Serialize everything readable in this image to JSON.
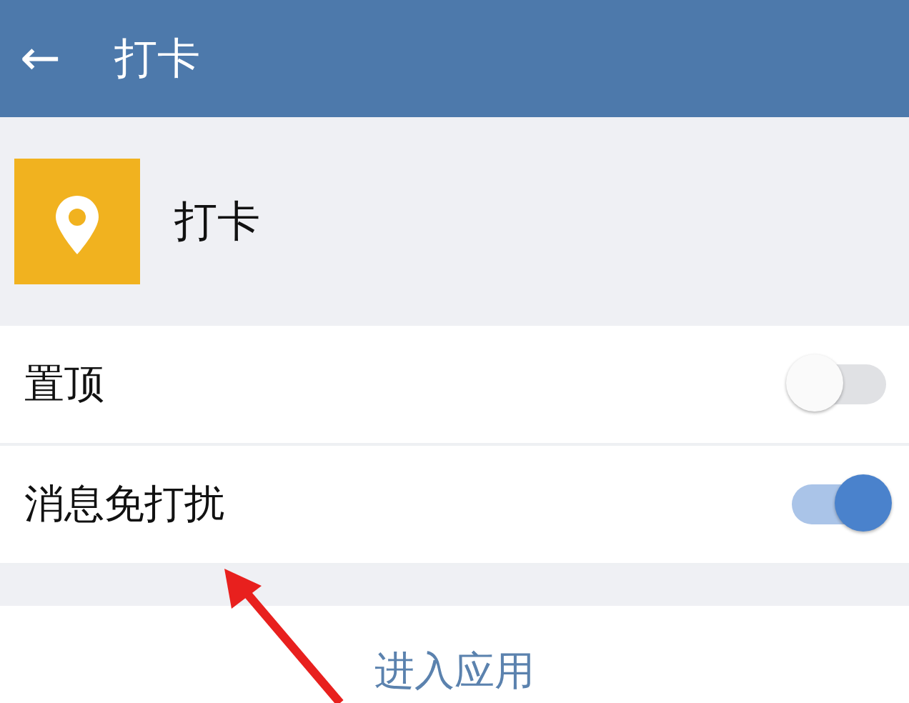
{
  "header": {
    "back": "←",
    "title": "打卡"
  },
  "app": {
    "name": "打卡"
  },
  "settings": [
    {
      "label": "置顶",
      "on": false
    },
    {
      "label": "消息免打扰",
      "on": true
    }
  ],
  "action": {
    "label": "进入应用"
  }
}
